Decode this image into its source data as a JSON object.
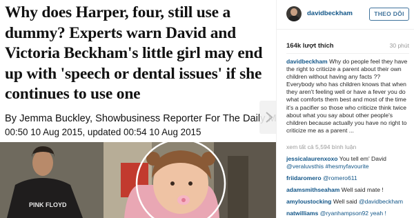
{
  "article": {
    "headline": "Why does Harper, four, still use a dummy? Experts warn David and Victoria Beckham's little girl may end up with 'speech or dental issues' if she continues to use one",
    "byline": "By Jemma Buckley, Showbusiness Reporter For The Daily Mail",
    "dateline": "00:50 10 Aug 2015, updated 00:54 10 Aug 2015",
    "shirt_text": "PINK FLOYD"
  },
  "instagram": {
    "username": "davidbeckham",
    "follow_label": "THEO DÕI",
    "likes": "164k lượt thích",
    "time_ago": "30 phút",
    "caption_user": "davidbeckham",
    "caption_text": "Why do people feel they have the right to criticize a parent about their own children without having any facts ?? Everybody who has children knows that when they aren't feeling well or have a fever you do what comforts them best and most of the time it's a pacifier so those who criticize think twice about what you say about other people's children because actually you have no right to criticize me as a parent ...",
    "view_all": "xem tất cả 5,594 bình luận",
    "comments": [
      {
        "user": "jessicalaurenxoxo",
        "text": "You tell em' David ",
        "tag": "@veraluvsthis #hesmyfavourite"
      },
      {
        "user": "friidaromero",
        "text": "",
        "tag": "@romero611"
      },
      {
        "user": "adamsmithseaham",
        "text": "Well said mate !",
        "tag": ""
      },
      {
        "user": "amyloustocking",
        "text": "Well said ",
        "tag": "@davidbeckham"
      },
      {
        "user": "natwilliams",
        "text": "",
        "tag": "@ryanhampson92 yeah !"
      }
    ]
  },
  "colors": {
    "link": "#125688",
    "follow": "#3f729b"
  }
}
